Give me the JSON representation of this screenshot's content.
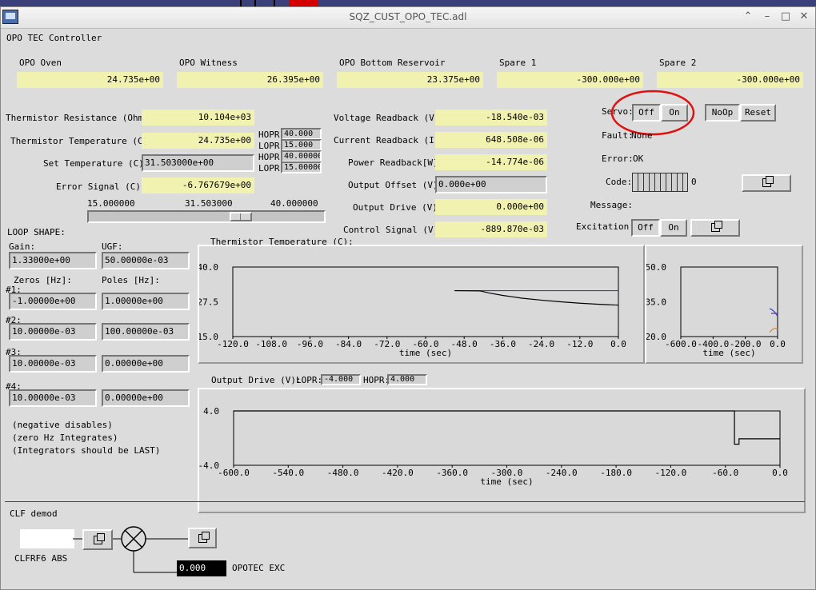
{
  "window": {
    "title": "SQZ_CUST_OPO_TEC.adl"
  },
  "controller": {
    "heading": "OPO TEC Controller",
    "channels": [
      {
        "label": "OPO Oven",
        "value": "24.735e+00"
      },
      {
        "label": "OPO Witness",
        "value": "26.395e+00"
      },
      {
        "label": "OPO Bottom Reservoir",
        "value": "23.375e+00"
      },
      {
        "label": "Spare 1",
        "value": "-300.000e+00"
      },
      {
        "label": "Spare 2",
        "value": "-300.000e+00"
      }
    ],
    "thermistor_resistance": {
      "label": "Thermistor Resistance (Ohm):",
      "value": "10.104e+03"
    },
    "thermistor_temperature": {
      "label": "Thermistor Temperature (C):",
      "value": "24.735e+00",
      "hopr_label": "HOPR:",
      "hopr": "40.000",
      "lopr_label": "LOPR:",
      "lopr": "15.000"
    },
    "set_temperature": {
      "label": "Set Temperature (C):",
      "value": "31.503000e+00",
      "hopr_label": "HOPR:",
      "hopr": "40.00000",
      "lopr_label": "LOPR:",
      "lopr": "15.00000"
    },
    "error_signal": {
      "label": "Error Signal (C):",
      "value": "-6.767679e+00"
    },
    "slider": {
      "min_label": "15.000000",
      "value_label": "31.503000",
      "max_label": "40.000000",
      "min": 15.0,
      "max": 40.0,
      "value": 31.503
    },
    "readbacks": [
      {
        "label": "Voltage Readback (V):",
        "value": "-18.540e-03"
      },
      {
        "label": "Current Readback (I):",
        "value": "648.508e-06"
      },
      {
        "label": "Power Readback[W]:",
        "value": "-14.774e-06"
      }
    ],
    "output_offset": {
      "label": "Output Offset (V):",
      "value": "0.000e+00"
    },
    "output_drive": {
      "label": "Output Drive (V):",
      "value": "0.000e+00"
    },
    "control_signal": {
      "label": "Control Signal (V):",
      "value": "-889.870e-03"
    },
    "servo": {
      "label": "Servo:",
      "off": "Off",
      "on": "On",
      "noop": "NoOp",
      "reset": "Reset"
    },
    "fault": {
      "label": "Fault:",
      "value": "None"
    },
    "error": {
      "label": "Error:",
      "value": "OK"
    },
    "code": {
      "label": "Code:",
      "value": "0"
    },
    "message": {
      "label": "Message:"
    },
    "excitation": {
      "label": "Excitation:",
      "off": "Off",
      "on": "On"
    }
  },
  "loop_shape": {
    "heading": "LOOP SHAPE:",
    "gain_label": "Gain:",
    "gain": "1.33000e+00",
    "ugf_label": "UGF:",
    "ugf": "50.00000e-03",
    "zeros_label": "Zeros [Hz]:",
    "poles_label": "Poles [Hz]:",
    "stages": [
      {
        "label": "#1:",
        "zero": "-1.00000e+00",
        "pole": "1.00000e+00"
      },
      {
        "label": "#2:",
        "zero": "10.00000e-03",
        "pole": "100.00000e-03"
      },
      {
        "label": "#3:",
        "zero": "10.00000e-03",
        "pole": "0.00000e+00"
      },
      {
        "label": "#4:",
        "zero": "10.00000e-03",
        "pole": "0.00000e+00"
      }
    ],
    "notes": [
      "(negative disables)",
      "(zero Hz Integrates)",
      "(Integrators should be LAST)"
    ]
  },
  "plots": {
    "temp_title": "Thermistor Temperature (C):",
    "drive_title": "Output Drive (V):",
    "drive_lopr_label": "LOPR:",
    "drive_lopr": "-4.000",
    "drive_hopr_label": "HOPR:",
    "drive_hopr": "4.000",
    "xlabel": "time (sec)",
    "colors": {
      "purple": "#6a2ca0",
      "blue": "#3a4ec0",
      "orange": "#d48a2a",
      "line": "#000000"
    }
  },
  "chart_data": [
    {
      "type": "line",
      "x_ticks": [
        "-120.0",
        "-108.0",
        "-96.0",
        "-84.0",
        "-72.0",
        "-60.0",
        "-48.0",
        "-36.0",
        "-24.0",
        "-12.0",
        "0.0"
      ],
      "y_ticks": [
        "40.0",
        "27.5",
        "15.0"
      ],
      "xlabel": "time (sec)",
      "xlim": [
        -120,
        0
      ],
      "ylim": [
        15,
        40
      ],
      "series": [
        {
          "x": [
            -51,
            0
          ],
          "y": [
            31.5,
            31.5
          ]
        },
        {
          "x": [
            -51,
            -43,
            -40,
            -36,
            -30,
            -24,
            -18,
            -12,
            -6,
            0
          ],
          "y": [
            31.5,
            31.4,
            30.6,
            29.8,
            28.8,
            28.1,
            27.5,
            27.0,
            26.6,
            26.3
          ]
        }
      ]
    },
    {
      "type": "line",
      "x_ticks": [
        "-600.0",
        "-400.0",
        "-200.0",
        "0.0"
      ],
      "y_ticks": [
        "50.0",
        "35.0",
        "20.0"
      ],
      "xlabel": "time (sec)",
      "xlim": [
        -600,
        0
      ],
      "ylim": [
        20,
        50
      ]
    },
    {
      "type": "line",
      "x_ticks": [
        "-600.0",
        "-540.0",
        "-480.0",
        "-420.0",
        "-360.0",
        "-300.0",
        "-240.0",
        "-180.0",
        "-120.0",
        "-60.0",
        "0.0"
      ],
      "y_ticks": [
        "4.0",
        "-4.0"
      ],
      "xlabel": "time (sec)",
      "xlim": [
        -600,
        0
      ],
      "ylim": [
        -4,
        4
      ],
      "series": [
        {
          "x": [
            -600,
            -50,
            -50,
            -45,
            -45,
            0
          ],
          "y": [
            4.0,
            4.0,
            -0.9,
            -0.9,
            -0.1,
            -0.1
          ]
        }
      ]
    }
  ],
  "clf": {
    "heading": "CLF demod",
    "input_label": "CLFRF6 ABS",
    "exc_value": "0.000",
    "exc_label": "OPOTEC EXC"
  }
}
